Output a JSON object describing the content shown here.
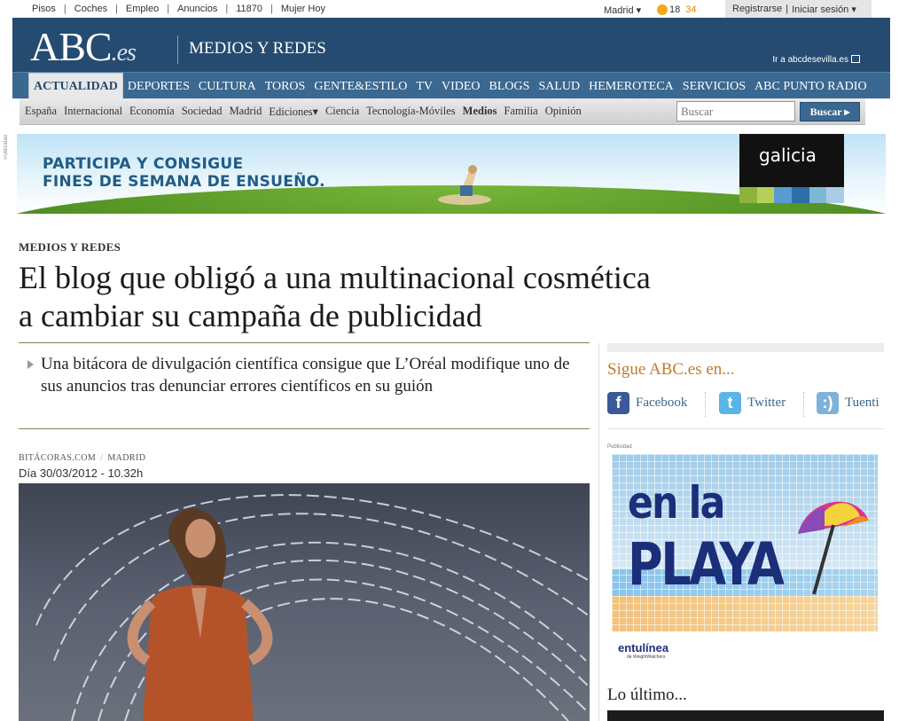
{
  "topbar": {
    "links": [
      "Pisos",
      "Coches",
      "Empleo",
      "Anuncios",
      "11870",
      "Mujer Hoy"
    ],
    "city": "Madrid ▾",
    "temp_low": "18",
    "temp_high": "34",
    "register": "Registrarse",
    "login": "Iniciar sesión ▾"
  },
  "header": {
    "logo_main": "ABC",
    "logo_ext": ".es",
    "section": "MEDIOS Y REDES",
    "sevilla_link": "Ir a abcdesevilla.es"
  },
  "main_nav": [
    "ACTUALIDAD",
    "DEPORTES",
    "CULTURA",
    "TOROS",
    "GENTE&ESTILO",
    "TV",
    "VIDEO",
    "BLOGS",
    "SALUD",
    "HEMEROTECA",
    "SERVICIOS",
    "ABC PUNTO RADIO"
  ],
  "sub_nav": [
    "España",
    "Internacional",
    "Economía",
    "Sociedad",
    "Madrid",
    "Ediciones▾",
    "Ciencia",
    "Tecnología-Móviles",
    "Medios",
    "Familia",
    "Opinión"
  ],
  "search": {
    "placeholder": "Buscar",
    "button": "Buscar ▸"
  },
  "banner": {
    "side_label": "Publicidad",
    "line1": "PARTICIPA Y CONSIGUE",
    "line2": "FINES DE SEMANA DE ENSUEÑO.",
    "brand": "galicia"
  },
  "article": {
    "kicker": "MEDIOS Y REDES",
    "headline_line1": "El blog que obligó a una multinacional cosmética",
    "headline_line2": "a cambiar su campaña de publicidad",
    "summary": "Una bitácora de divulgación científica consigue que L’Oréal modifique uno de sus anuncios tras denunciar errores científicos en su guión",
    "source": "BITÁCORAS.COM",
    "location": "MADRID",
    "date": "Día 30/03/2012 - 10.32h"
  },
  "sidebar": {
    "follow_title": "Sigue ABC.es en...",
    "social": [
      {
        "label": "Facebook",
        "icon": "facebook-icon",
        "color": "#3b5998"
      },
      {
        "label": "Twitter",
        "icon": "twitter-icon",
        "color": "#5ab4e8"
      },
      {
        "label": "Tuenti",
        "icon": "tuenti-icon",
        "color": "#7fb2d8"
      }
    ],
    "ad_label": "Publicidad",
    "ad_line1": "en la",
    "ad_line2": "PLAYA",
    "ad_brand": "entulínea",
    "ad_brand_sub": "de WeightWatchers",
    "latest_title": "Lo último..."
  }
}
